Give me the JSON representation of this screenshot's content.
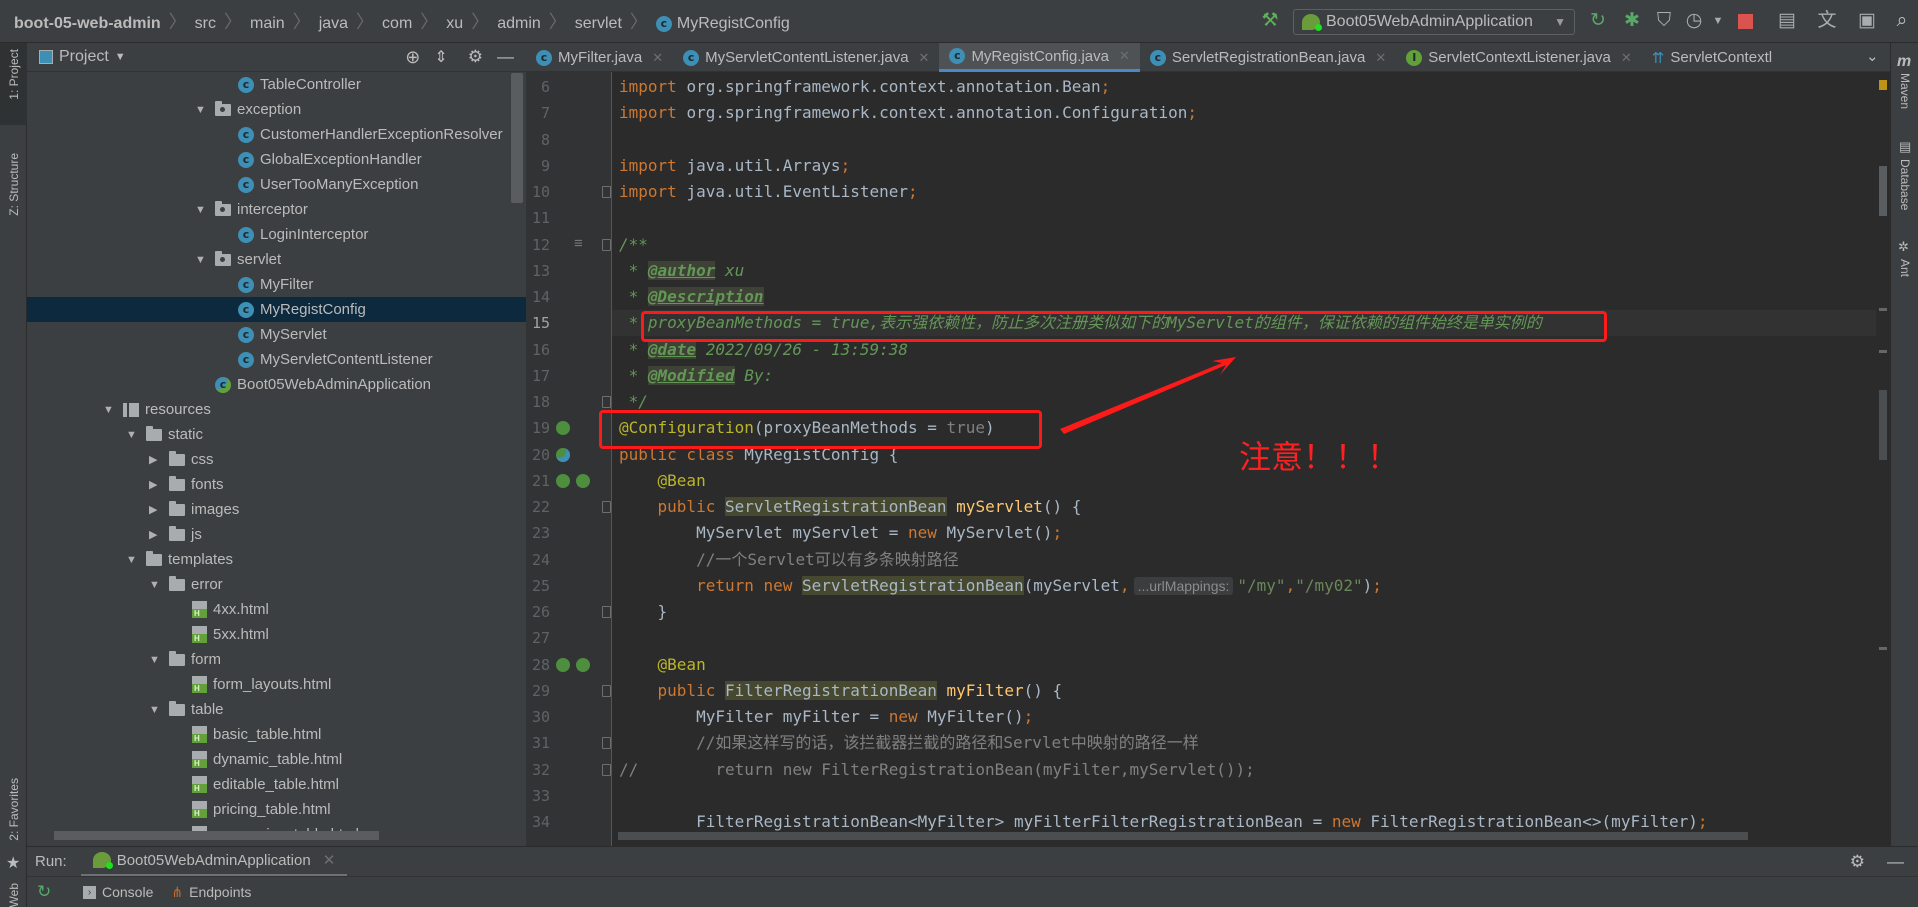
{
  "breadcrumb": [
    "boot-05-web-admin",
    "src",
    "main",
    "java",
    "com",
    "xu",
    "admin",
    "servlet",
    "MyRegistConfig"
  ],
  "toolbar": {
    "run_config": "Boot05WebAdminApplication",
    "icons": [
      "hammer-icon",
      "rerun-icon",
      "debug-icon",
      "coverage-icon",
      "profile-icon",
      "dropdown-icon",
      "stop-icon",
      "project-structure-icon",
      "translate-icon",
      "terminal-icon",
      "search-icon"
    ]
  },
  "left_strip": {
    "project": "1: Project",
    "structure": "Z: Structure",
    "favorites": "2: Favorites",
    "web": "Web"
  },
  "right_strip": {
    "maven": "Maven",
    "database": "Database",
    "ant": "Ant"
  },
  "project_panel": {
    "title": "Project",
    "items": [
      {
        "label": "TableController",
        "type": "class",
        "level": 5
      },
      {
        "label": "exception",
        "type": "package",
        "level": 4,
        "expanded": true
      },
      {
        "label": "CustomerHandlerExceptionResolver",
        "type": "class",
        "level": 5
      },
      {
        "label": "GlobalExceptionHandler",
        "type": "class",
        "level": 5
      },
      {
        "label": "UserTooManyException",
        "type": "class",
        "level": 5
      },
      {
        "label": "interceptor",
        "type": "package",
        "level": 4,
        "expanded": true
      },
      {
        "label": "LoginInterceptor",
        "type": "class",
        "level": 5
      },
      {
        "label": "servlet",
        "type": "package",
        "level": 4,
        "expanded": true
      },
      {
        "label": "MyFilter",
        "type": "class",
        "level": 5
      },
      {
        "label": "MyRegistConfig",
        "type": "class",
        "level": 5,
        "selected": true
      },
      {
        "label": "MyServlet",
        "type": "class",
        "level": 5
      },
      {
        "label": "MyServletContentListener",
        "type": "class",
        "level": 5
      },
      {
        "label": "Boot05WebAdminApplication",
        "type": "springclass",
        "level": 4
      },
      {
        "label": "resources",
        "type": "resources",
        "level": 0,
        "expanded": true
      },
      {
        "label": "static",
        "type": "folder",
        "level": 1,
        "expanded": true
      },
      {
        "label": "css",
        "type": "folder",
        "level": 2,
        "expanded": false
      },
      {
        "label": "fonts",
        "type": "folder",
        "level": 2,
        "expanded": false
      },
      {
        "label": "images",
        "type": "folder",
        "level": 2,
        "expanded": false
      },
      {
        "label": "js",
        "type": "folder",
        "level": 2,
        "expanded": false
      },
      {
        "label": "templates",
        "type": "folder",
        "level": 1,
        "expanded": true
      },
      {
        "label": "error",
        "type": "folder",
        "level": 2,
        "expanded": true
      },
      {
        "label": "4xx.html",
        "type": "html",
        "level": 3
      },
      {
        "label": "5xx.html",
        "type": "html",
        "level": 3
      },
      {
        "label": "form",
        "type": "folder",
        "level": 2,
        "expanded": true
      },
      {
        "label": "form_layouts.html",
        "type": "html",
        "level": 3
      },
      {
        "label": "table",
        "type": "folder",
        "level": 2,
        "expanded": true
      },
      {
        "label": "basic_table.html",
        "type": "html",
        "level": 3
      },
      {
        "label": "dynamic_table.html",
        "type": "html",
        "level": 3
      },
      {
        "label": "editable_table.html",
        "type": "html",
        "level": 3
      },
      {
        "label": "pricing_table.html",
        "type": "html",
        "level": 3
      },
      {
        "label": "responsive_table.html",
        "type": "html",
        "level": 3
      }
    ]
  },
  "tabs": [
    {
      "label": "MyFilter.java",
      "icon": "class"
    },
    {
      "label": "MyServletContentListener.java",
      "icon": "class"
    },
    {
      "label": "MyRegistConfig.java",
      "icon": "class",
      "active": true
    },
    {
      "label": "ServletRegistrationBean.java",
      "icon": "class"
    },
    {
      "label": "ServletContextListener.java",
      "icon": "interface"
    },
    {
      "label": "ServletContextl",
      "icon": "annotation-type"
    }
  ],
  "editor": {
    "current_line": 15,
    "lines": [
      {
        "n": 6,
        "t": [
          [
            "import ",
            "kw"
          ],
          [
            "org.springframework.context.annotation.Bean",
            ""
          ],
          [
            ";",
            "kw"
          ]
        ]
      },
      {
        "n": 7,
        "t": [
          [
            "import ",
            "kw"
          ],
          [
            "org.springframework.context.annotation.Configuration",
            ""
          ],
          [
            ";",
            "kw"
          ]
        ]
      },
      {
        "n": 8,
        "t": []
      },
      {
        "n": 9,
        "t": [
          [
            "import ",
            "kw"
          ],
          [
            "java.util.Arrays",
            ""
          ],
          [
            ";",
            "kw"
          ]
        ]
      },
      {
        "n": 10,
        "t": [
          [
            "import ",
            "kw"
          ],
          [
            "java.util.EventListener",
            ""
          ],
          [
            ";",
            "kw"
          ]
        ]
      },
      {
        "n": 11,
        "t": []
      },
      {
        "n": 12,
        "t": [
          [
            "/**",
            "doc"
          ]
        ]
      },
      {
        "n": 13,
        "t": [
          [
            " * ",
            "doc"
          ],
          [
            "@author",
            "tag"
          ],
          [
            " xu",
            "doc"
          ]
        ]
      },
      {
        "n": 14,
        "t": [
          [
            " * ",
            "doc"
          ],
          [
            "@Description",
            "tag"
          ]
        ]
      },
      {
        "n": 15,
        "t": [
          [
            " * proxyBeanMethods = true,表示强依赖性，防止多次注册类似如下的MyServlet的组件，保证依赖的组件始终是单实例的",
            "doc"
          ]
        ]
      },
      {
        "n": 16,
        "t": [
          [
            " * ",
            "doc"
          ],
          [
            "@date",
            "tag"
          ],
          [
            " 2022/09/26 - 13:59:38",
            "doc"
          ]
        ]
      },
      {
        "n": 17,
        "t": [
          [
            " * ",
            "doc"
          ],
          [
            "@Modified",
            "tag"
          ],
          [
            " By:",
            "doc"
          ]
        ]
      },
      {
        "n": 18,
        "t": [
          [
            " */",
            "doc"
          ]
        ]
      },
      {
        "n": 19,
        "t": [
          [
            "@Configuration",
            "ann"
          ],
          [
            "(proxyBeanMethods = ",
            ""
          ],
          [
            "true",
            "dim"
          ],
          [
            ")",
            ""
          ]
        ]
      },
      {
        "n": 20,
        "t": [
          [
            "public class ",
            "kw"
          ],
          [
            "MyRegistConfig {",
            ""
          ]
        ]
      },
      {
        "n": 21,
        "t": [
          [
            "    ",
            ""
          ],
          [
            "@Bean",
            "ann"
          ]
        ]
      },
      {
        "n": 22,
        "t": [
          [
            "    public ",
            "kw"
          ],
          [
            "ServletRegistrationBean",
            "hl"
          ],
          [
            " ",
            ""
          ],
          [
            "myServlet",
            "fn"
          ],
          [
            "() {",
            ""
          ]
        ]
      },
      {
        "n": 23,
        "t": [
          [
            "        MyServlet myServlet = ",
            ""
          ],
          [
            "new ",
            "kw"
          ],
          [
            "MyServlet()",
            ""
          ],
          [
            ";",
            "kw"
          ]
        ]
      },
      {
        "n": 24,
        "t": [
          [
            "        //一个Servlet可以有多条映射路径",
            "cmt"
          ]
        ]
      },
      {
        "n": 25,
        "t": [
          [
            "        return new ",
            "kw"
          ],
          [
            "ServletRegistrationBean",
            "hl"
          ],
          [
            "(myServlet",
            ""
          ],
          [
            ",",
            "kw"
          ],
          [
            "...urlMappings:",
            "hint"
          ],
          [
            "\"/my\"",
            "str"
          ],
          [
            ",",
            "kw"
          ],
          [
            "\"/my02\"",
            "str"
          ],
          [
            ")",
            ""
          ],
          [
            ";",
            "kw"
          ]
        ]
      },
      {
        "n": 26,
        "t": [
          [
            "    }",
            ""
          ]
        ]
      },
      {
        "n": 27,
        "t": []
      },
      {
        "n": 28,
        "t": [
          [
            "    ",
            ""
          ],
          [
            "@Bean",
            "ann"
          ]
        ]
      },
      {
        "n": 29,
        "t": [
          [
            "    public ",
            "kw"
          ],
          [
            "FilterRegistrationBean",
            "hl"
          ],
          [
            " ",
            ""
          ],
          [
            "myFilter",
            "fn"
          ],
          [
            "() {",
            ""
          ]
        ]
      },
      {
        "n": 30,
        "t": [
          [
            "        MyFilter myFilter = ",
            ""
          ],
          [
            "new ",
            "kw"
          ],
          [
            "MyFilter()",
            ""
          ],
          [
            ";",
            "kw"
          ]
        ]
      },
      {
        "n": 31,
        "t": [
          [
            "        //如果这样写的话，该拦截器拦截的路径和Servlet中映射的路径一样",
            "cmt"
          ]
        ]
      },
      {
        "n": 32,
        "t": [
          [
            "//        return new FilterRegistrationBean(myFilter,myServlet());",
            "cmt"
          ]
        ]
      },
      {
        "n": 33,
        "t": []
      },
      {
        "n": 34,
        "t": [
          [
            "        FilterRegistrationBean<MyFilter> myFilterFilterRegistrationBean = ",
            ""
          ],
          [
            "new ",
            "kw"
          ],
          [
            "FilterRegistrationBean<>(myFilter)",
            ""
          ],
          [
            ";",
            "kw"
          ]
        ]
      }
    ]
  },
  "annotation_note": "注意！！！",
  "annotation_color": "#ff1a1a",
  "run_panel": {
    "label": "Run:",
    "tab": "Boot05WebAdminApplication",
    "console": "Console",
    "endpoints": "Endpoints"
  }
}
